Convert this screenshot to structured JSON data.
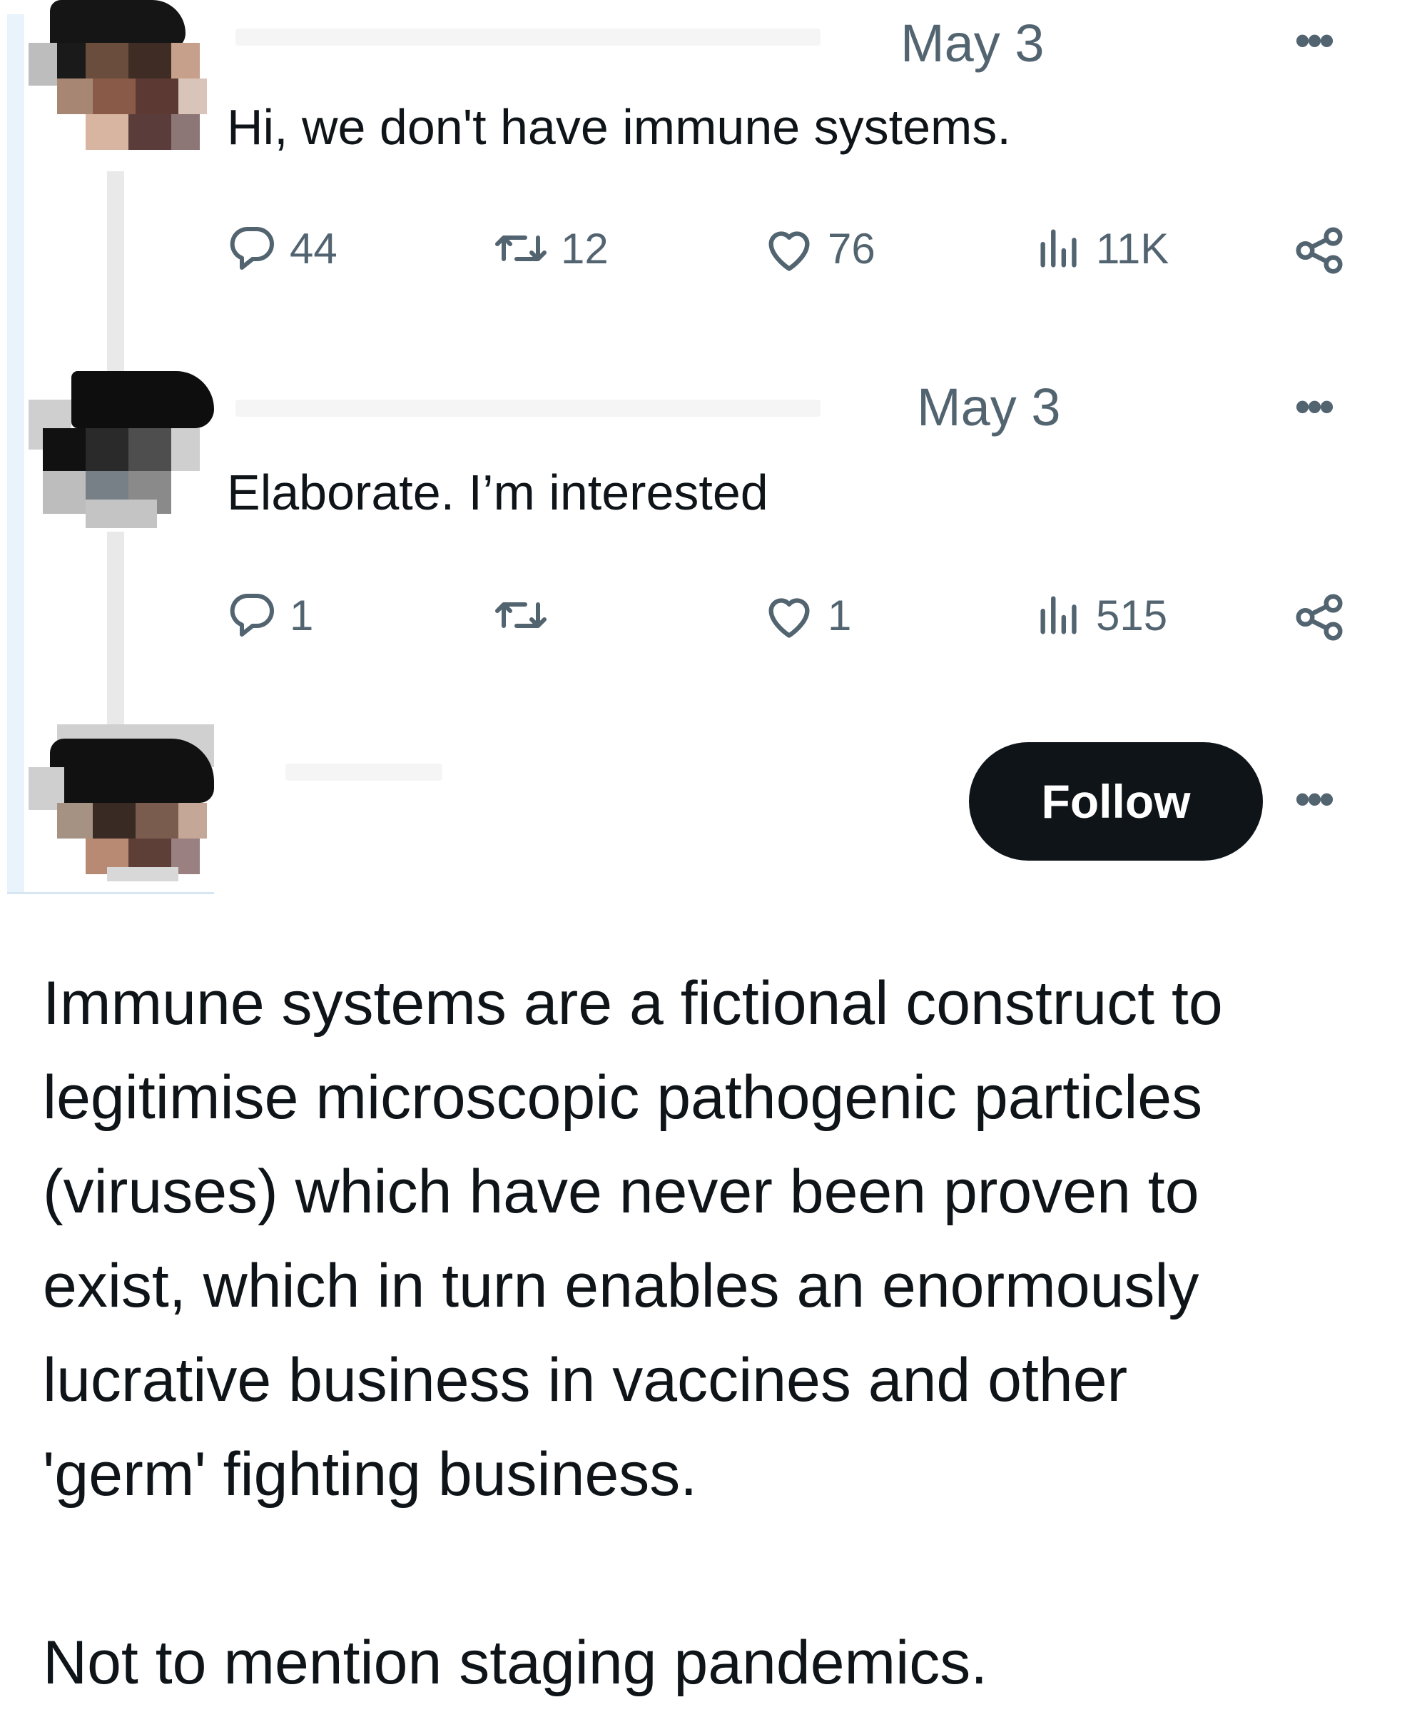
{
  "thread": {
    "posts": [
      {
        "date": "May 3",
        "text": "Hi, we don't have immune systems.",
        "menu_label": "•••",
        "actions": {
          "replies": "44",
          "reposts": "12",
          "likes": "76",
          "views": "11K"
        },
        "icons": [
          "reply-icon",
          "repost-icon",
          "like-icon",
          "views-icon",
          "share-icon"
        ]
      },
      {
        "date": "May 3",
        "text": "Elaborate. I’m interested",
        "menu_label": "•••",
        "actions": {
          "replies": "1",
          "reposts": "",
          "likes": "1",
          "views": "515"
        },
        "icons": [
          "reply-icon",
          "repost-icon",
          "like-icon",
          "views-icon",
          "share-icon"
        ]
      }
    ]
  },
  "reply": {
    "follow_label": "Follow",
    "menu_label": "•••",
    "paragraphs": [
      "Immune systems are a fictional construct to\nlegitimise microscopic pathogenic particles\n(viruses) which have never been proven to\nexist, which in turn enables an enormously\nlucrative business in vaccines and other\n'germ' fighting business.",
      "Not to mention staging pandemics."
    ]
  },
  "colors": {
    "text": "#0f1419",
    "muted": "#536471",
    "button_bg": "#0f1419",
    "button_text": "#ffffff",
    "thread_bar": "#e8f3fb"
  }
}
